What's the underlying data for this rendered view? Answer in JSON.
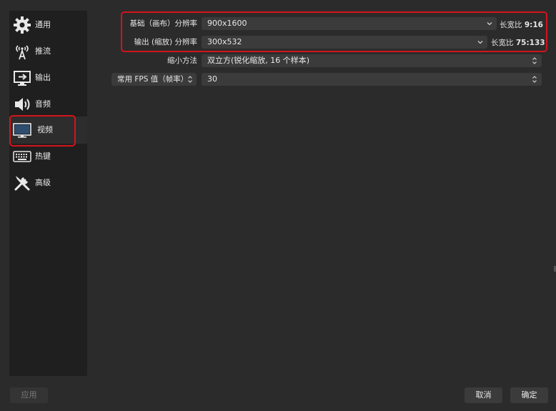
{
  "sidebar": {
    "items": [
      {
        "label": "通用",
        "icon": "gear-icon"
      },
      {
        "label": "推流",
        "icon": "broadcast-icon"
      },
      {
        "label": "输出",
        "icon": "output-icon"
      },
      {
        "label": "音频",
        "icon": "speaker-icon"
      },
      {
        "label": "视频",
        "icon": "monitor-icon"
      },
      {
        "label": "热键",
        "icon": "keyboard-icon"
      },
      {
        "label": "高级",
        "icon": "tools-icon"
      }
    ],
    "active": "视频"
  },
  "video": {
    "base_resolution": {
      "label": "基础（画布）分辨率",
      "value": "900x1600",
      "ratio_label": "长宽比",
      "ratio_value": "9:16"
    },
    "output_resolution": {
      "label": "输出 (缩放) 分辨率",
      "value": "300x532",
      "ratio_label": "长宽比",
      "ratio_value": "75:133"
    },
    "downscale": {
      "label": "缩小方法",
      "value": "双立方(锐化缩放, 16 个样本)"
    },
    "fps": {
      "label": "常用 FPS 值（帧率）",
      "value": "30"
    }
  },
  "footer": {
    "apply_label": "应用",
    "cancel_label": "取消",
    "ok_label": "确定"
  },
  "colors": {
    "highlight": "#d2141b",
    "background": "#2b2b2b",
    "sidebar": "#1f1f1f",
    "field": "#3b3b3b"
  }
}
